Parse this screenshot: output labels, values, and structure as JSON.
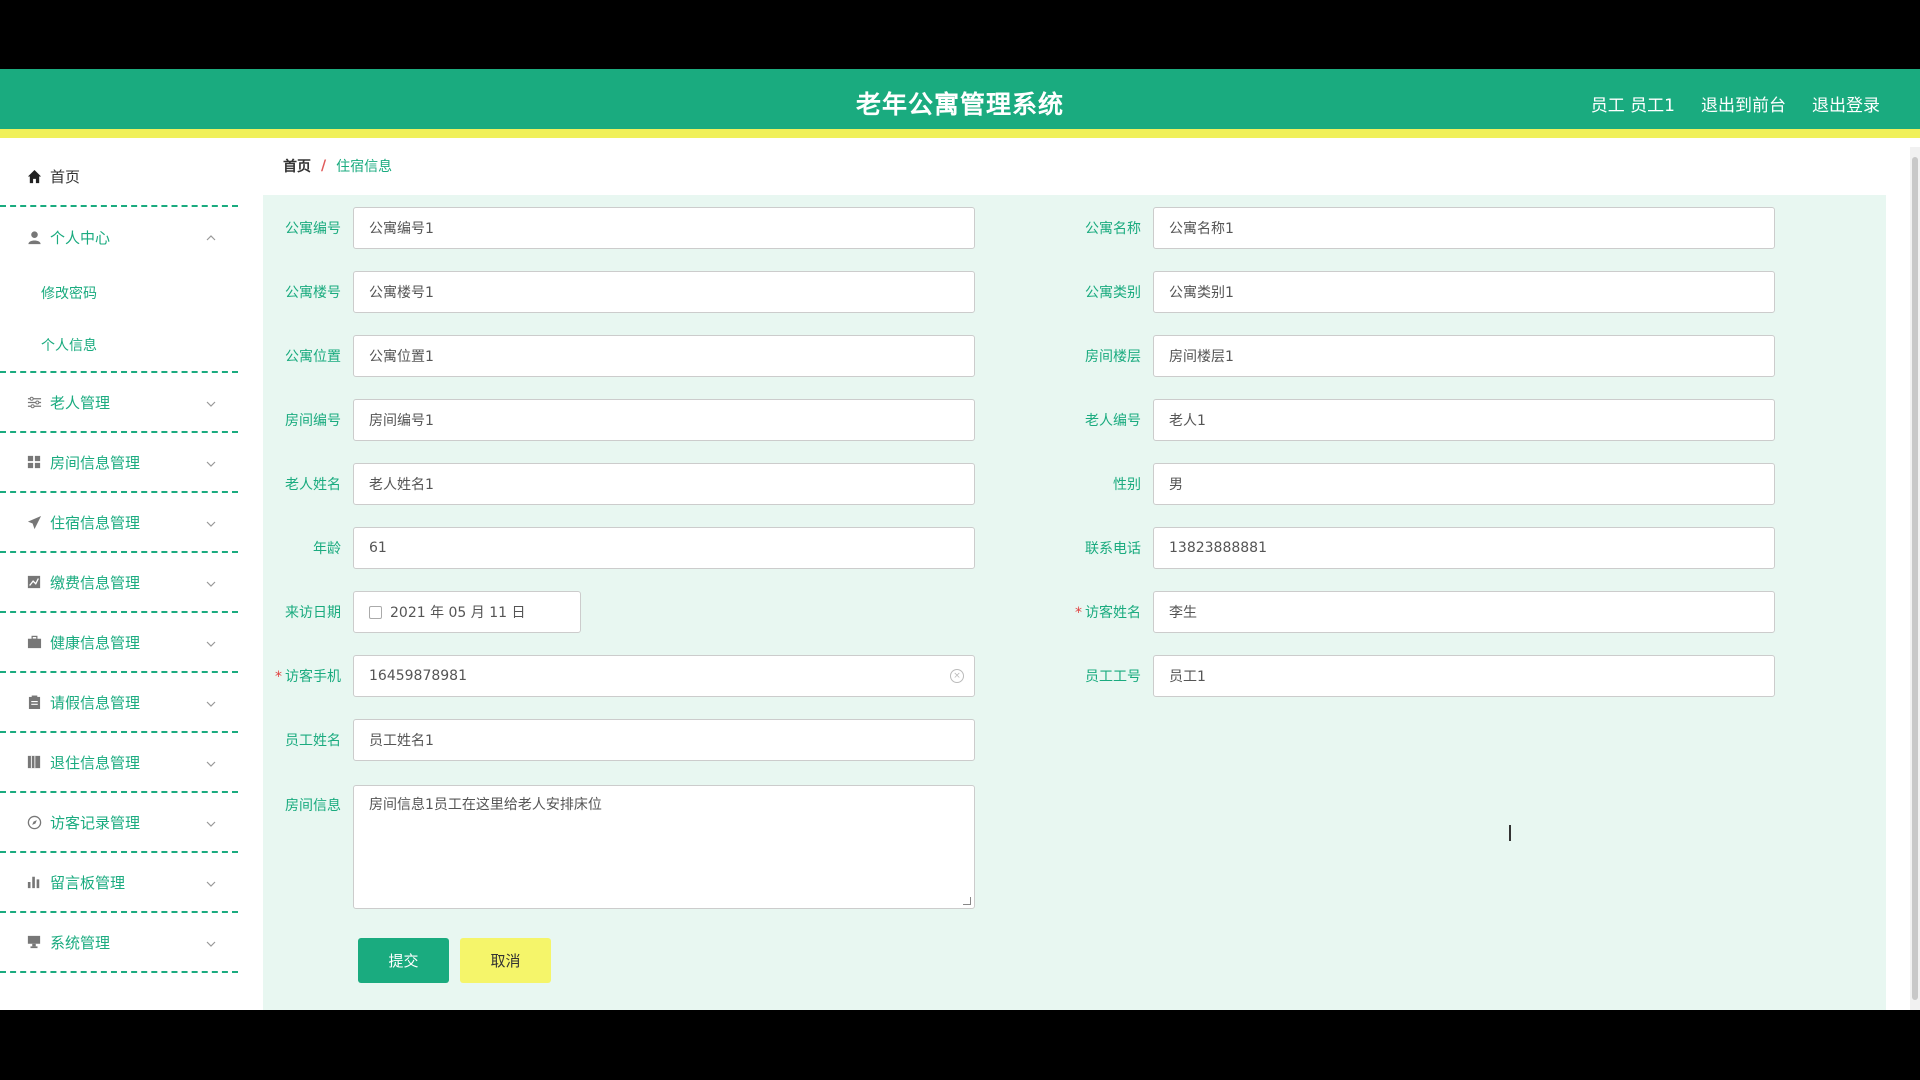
{
  "header": {
    "title": "老年公寓管理系统",
    "user": "员工 员工1",
    "back_to_front": "退出到前台",
    "logout": "退出登录"
  },
  "sidebar": {
    "home": "首页",
    "personal_center": "个人中心",
    "change_password": "修改密码",
    "personal_info": "个人信息",
    "items": [
      {
        "label": "老人管理",
        "icon": "sliders-icon"
      },
      {
        "label": "房间信息管理",
        "icon": "grid-icon"
      },
      {
        "label": "住宿信息管理",
        "icon": "send-icon"
      },
      {
        "label": "缴费信息管理",
        "icon": "chart-icon"
      },
      {
        "label": "健康信息管理",
        "icon": "briefcase-icon"
      },
      {
        "label": "请假信息管理",
        "icon": "clipboard-icon"
      },
      {
        "label": "退住信息管理",
        "icon": "book-icon"
      },
      {
        "label": "访客记录管理",
        "icon": "compass-icon"
      },
      {
        "label": "留言板管理",
        "icon": "bar-chart-icon"
      },
      {
        "label": "系统管理",
        "icon": "monitor-icon"
      }
    ]
  },
  "breadcrumb": {
    "home": "首页",
    "separator": "/",
    "current": "住宿信息"
  },
  "form": {
    "apartment_no": {
      "label": "公寓编号",
      "value": "公寓编号1"
    },
    "apartment_name": {
      "label": "公寓名称",
      "value": "公寓名称1"
    },
    "building_no": {
      "label": "公寓楼号",
      "value": "公寓楼号1"
    },
    "apartment_type": {
      "label": "公寓类别",
      "value": "公寓类别1"
    },
    "location": {
      "label": "公寓位置",
      "value": "公寓位置1"
    },
    "room_floor": {
      "label": "房间楼层",
      "value": "房间楼层1"
    },
    "room_no": {
      "label": "房间编号",
      "value": "房间编号1"
    },
    "elder_no": {
      "label": "老人编号",
      "value": "老人1"
    },
    "elder_name": {
      "label": "老人姓名",
      "value": "老人姓名1"
    },
    "gender": {
      "label": "性别",
      "value": "男"
    },
    "age": {
      "label": "年龄",
      "value": "61"
    },
    "phone": {
      "label": "联系电话",
      "value": "13823888881"
    },
    "visit_date": {
      "label": "来访日期",
      "value": "2021 年 05 月 11 日"
    },
    "visitor_name": {
      "label": "访客姓名",
      "value": "李生",
      "required_mark": "*"
    },
    "visitor_phone": {
      "label": "访客手机",
      "value": "16459878981",
      "required_mark": "*"
    },
    "staff_no": {
      "label": "员工工号",
      "value": "员工1"
    },
    "staff_name": {
      "label": "员工姓名",
      "value": "员工姓名1"
    },
    "room_info": {
      "label": "房间信息",
      "value": "房间信息1员工在这里给老人安排床位"
    }
  },
  "buttons": {
    "submit": "提交",
    "cancel": "取消"
  },
  "colors": {
    "primary": "#1aab7f",
    "accent_yellow": "#f0f05a"
  }
}
